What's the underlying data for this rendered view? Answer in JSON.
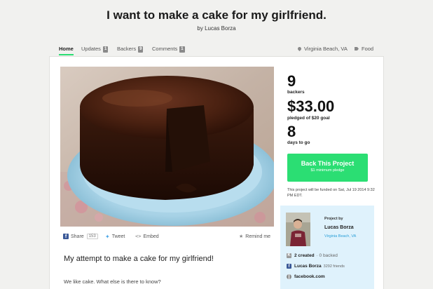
{
  "project": {
    "title": "I want to make a cake for my girlfriend.",
    "byline": "by Lucas Borza"
  },
  "nav": {
    "home": "Home",
    "updates": "Updates",
    "updates_count": "1",
    "backers": "Backers",
    "backers_count": "9",
    "comments": "Comments",
    "comments_count": "1",
    "location": "Virginia Beach, VA",
    "category": "Food"
  },
  "share": {
    "facebook": "Share",
    "facebook_count": "153",
    "tweet": "Tweet",
    "embed": "Embed",
    "remind": "Remind me"
  },
  "description": {
    "heading": "My attempt to make a cake for my girlfriend!",
    "body": "We like cake. What else is there to know?"
  },
  "stats": {
    "backers_value": "9",
    "backers_label": "backers",
    "pledged_value": "$33.00",
    "pledged_label": "pledged of $20 goal",
    "days_value": "8",
    "days_label": "days to go"
  },
  "cta": {
    "button_label": "Back This Project",
    "button_sub": "$1 minimum pledge",
    "funded_note": "This project will be funded on Sat, Jul 19 2014 9:32 PM EDT."
  },
  "creator": {
    "project_by": "Project by",
    "name": "Lucas Borza",
    "location": "Virginia Beach, VA",
    "created": "2 created",
    "backed": "· 0 backed",
    "facebook_name": "Lucas Borza",
    "facebook_friends": "3292 friends",
    "website": "facebook.com"
  },
  "colors": {
    "accent_green": "#2bde73",
    "creator_panel": "#dff2fc",
    "link_blue": "#2a9fd8",
    "facebook_blue": "#3b5998",
    "twitter_blue": "#4ba7e8"
  },
  "icons": {
    "location": "map-pin-icon",
    "category": "tag-icon",
    "share": "facebook-icon",
    "tweet": "twitter-icon",
    "embed": "code-icon",
    "remind": "star-icon",
    "created": "kickstarter-icon",
    "facebook": "facebook-icon",
    "website": "globe-icon"
  }
}
